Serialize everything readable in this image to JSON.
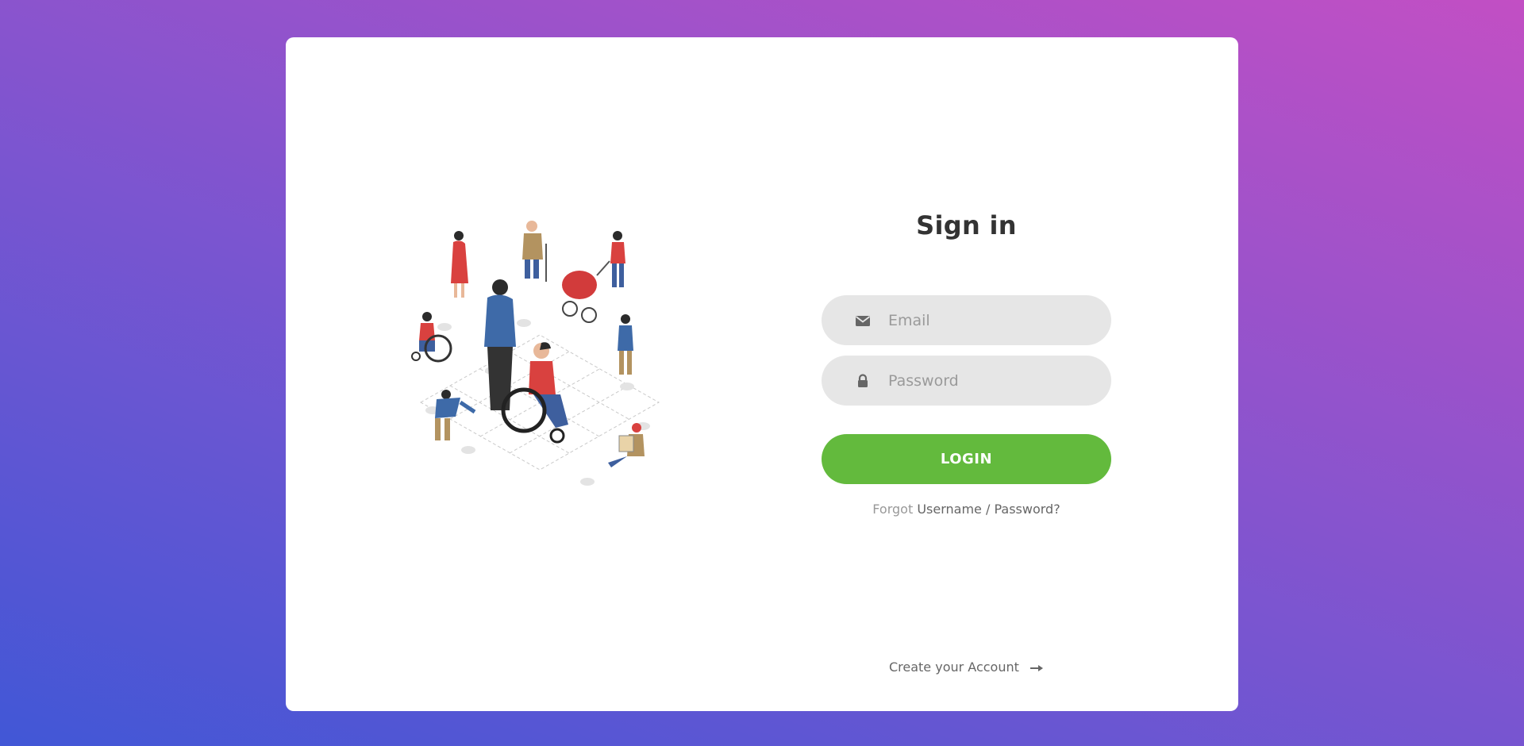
{
  "login": {
    "title": "Sign in",
    "email_placeholder": "Email",
    "password_placeholder": "Password",
    "login_label": "LOGIN",
    "forgot_prefix": "Forgot",
    "forgot_link": "Username / Password?",
    "create_account": "Create your Account"
  },
  "icons": {
    "email": "envelope-icon",
    "password": "lock-icon",
    "create_arrow": "arrow-right-icon"
  },
  "colors": {
    "background_start": "#4157d6",
    "background_end": "#c24fc4",
    "card": "#ffffff",
    "input_bg": "#e6e6e6",
    "login_button": "#63ba3d",
    "title_text": "#333333"
  }
}
